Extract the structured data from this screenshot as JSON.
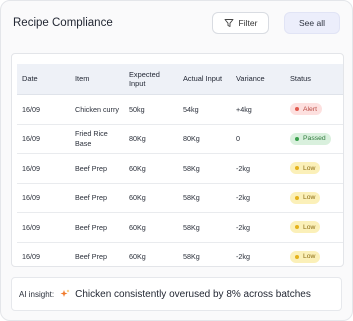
{
  "header": {
    "title": "Recipe Compliance",
    "filter_label": "Filter",
    "see_all_label": "See all"
  },
  "table": {
    "columns": [
      "Date",
      "Item",
      "Expected Input",
      "Actual Input",
      "Variance",
      "Status"
    ],
    "rows": [
      {
        "date": "16/09",
        "item": "Chicken curry",
        "expected": "50kg",
        "actual": "54kg",
        "variance": "+4kg",
        "status": "Alert"
      },
      {
        "date": "16/09",
        "item": "Fried Rice Base",
        "expected": "80Kg",
        "actual": "80Kg",
        "variance": "0",
        "status": "Passed"
      },
      {
        "date": "16/09",
        "item": "Beef Prep",
        "expected": "60Kg",
        "actual": "58Kg",
        "variance": "-2kg",
        "status": "Low"
      },
      {
        "date": "16/09",
        "item": "Beef Prep",
        "expected": "60Kg",
        "actual": "58Kg",
        "variance": "-2kg",
        "status": "Low"
      },
      {
        "date": "16/09",
        "item": "Beef Prep",
        "expected": "60Kg",
        "actual": "58Kg",
        "variance": "-2kg",
        "status": "Low"
      },
      {
        "date": "16/09",
        "item": "Beef Prep",
        "expected": "60Kg",
        "actual": "58Kg",
        "variance": "-2kg",
        "status": "Low"
      }
    ]
  },
  "insight": {
    "label": "AI insight:",
    "icon": "sparkle-icon",
    "text": "Chicken consistently overused by 8% across batches"
  },
  "colors": {
    "alert": "#e15a4f",
    "passed": "#3aa14d",
    "low": "#e5b21c",
    "header_bg": "#eef1f7",
    "see_all_bg": "#eceefb"
  }
}
